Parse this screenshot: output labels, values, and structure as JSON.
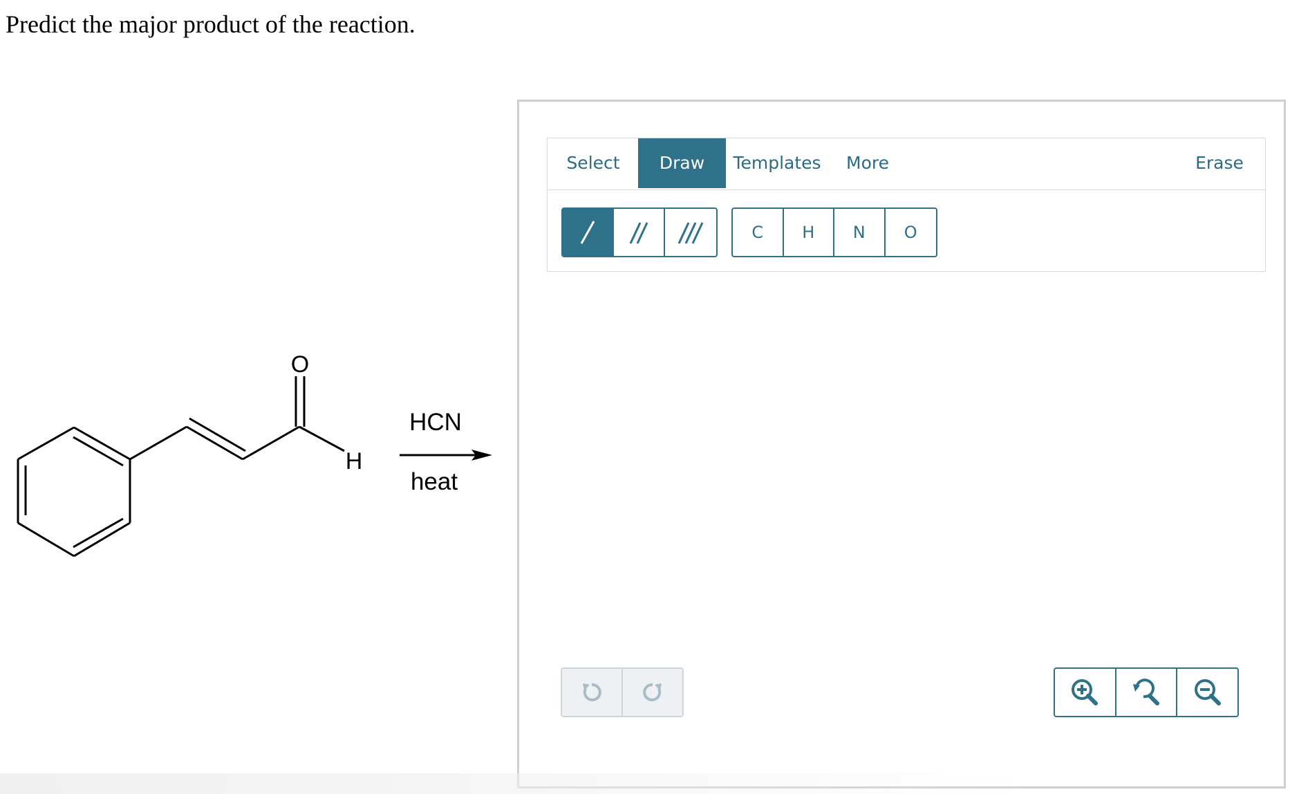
{
  "question": "Predict the major product of the reaction.",
  "reaction": {
    "reagent": "HCN",
    "condition": "heat",
    "atom_o": "O",
    "atom_h": "H"
  },
  "editor": {
    "tabs": [
      {
        "label": "Select",
        "active": false
      },
      {
        "label": "Draw",
        "active": true
      },
      {
        "label": "Templates",
        "active": false
      },
      {
        "label": "More",
        "active": false
      }
    ],
    "erase_label": "Erase",
    "bond_tools": [
      "single-bond",
      "double-bond",
      "triple-bond"
    ],
    "atoms": [
      "C",
      "H",
      "N",
      "O"
    ]
  },
  "colors": {
    "accent": "#2e7189",
    "tab_text": "#2a6b86",
    "disabled_bg": "#eef1f3"
  }
}
